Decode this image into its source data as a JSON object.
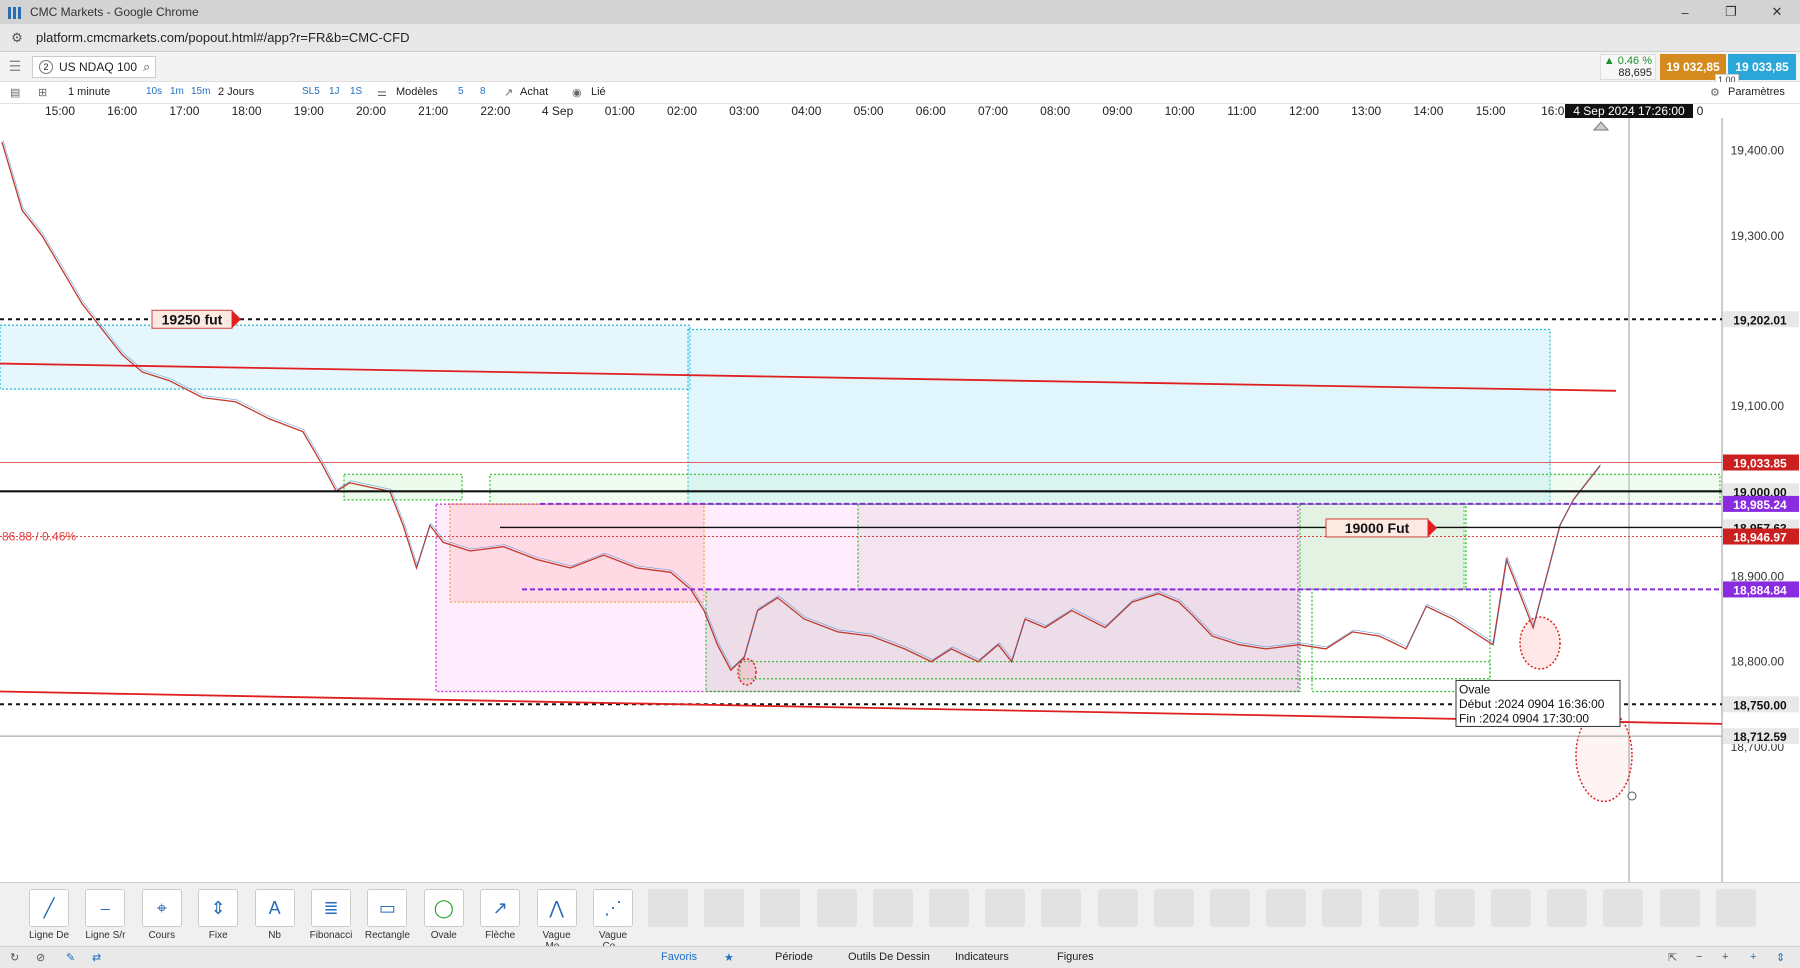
{
  "window": {
    "title": "CMC Markets - Google Chrome",
    "controls": [
      "–",
      "❐",
      "✕"
    ]
  },
  "address": {
    "url": "platform.cmcmarkets.com/popout.html#/app?r=FR&b=CMC-CFD"
  },
  "instrument": {
    "number": "2",
    "name": "US NDAQ 100"
  },
  "quote": {
    "change_pct": "▲ 0.46 %",
    "change_pts": "88,695",
    "sell": "19 032,85",
    "buy": "19 033,85",
    "lot": "1.00"
  },
  "toolbar": {
    "interval": "1 minute",
    "intervals": [
      "10s",
      "1m",
      "15m"
    ],
    "range": "2 Jours",
    "sl_buttons": [
      "SL5",
      "1J",
      "1S"
    ],
    "modeles": "Modèles",
    "counts": [
      "5",
      "8"
    ],
    "achat": "Achat",
    "lie": "Lié",
    "parametres": "Paramètres"
  },
  "chart_data": {
    "type": "candlestick",
    "instrument": "US NDAQ 100",
    "x_tick_labels": [
      "15:00",
      "16:00",
      "17:00",
      "18:00",
      "19:00",
      "20:00",
      "21:00",
      "22:00",
      "4 Sep",
      "01:00",
      "02:00",
      "03:00",
      "04:00",
      "05:00",
      "06:00",
      "07:00",
      "08:00",
      "09:00",
      "10:00",
      "11:00",
      "12:00",
      "13:00",
      "14:00",
      "15:00",
      "16:0"
    ],
    "crosshair_time": "4 Sep 2024 17:26:00",
    "crosshair_tail": "0",
    "y_tick_labels": [
      "19,400.00",
      "19,300.00",
      "19,200.00",
      "19,100.00",
      "19,000.00",
      "18,900.00",
      "18,800.00",
      "18,700.00"
    ],
    "ylim": [
      18640,
      19450
    ],
    "price_tags": [
      {
        "value": 19202.01,
        "label": "19,202.01",
        "bg": "#e8e8e8",
        "fg": "#111"
      },
      {
        "value": 19033.85,
        "label": "19,033.85",
        "bg": "#cc1f1f",
        "fg": "#fff"
      },
      {
        "value": 19000.0,
        "label": "19,000.00",
        "bg": "#e8e8e8",
        "fg": "#111"
      },
      {
        "value": 18985.24,
        "label": "18,985.24",
        "bg": "#8a2be2",
        "fg": "#fff"
      },
      {
        "value": 18957.63,
        "label": "18,957.63",
        "bg": "#e8e8e8",
        "fg": "#111"
      },
      {
        "value": 18946.97,
        "label": "18,946.97",
        "bg": "#cc1f1f",
        "fg": "#fff"
      },
      {
        "value": 18884.84,
        "label": "18,884.84",
        "bg": "#8a2be2",
        "fg": "#fff"
      },
      {
        "value": 18750.0,
        "label": "18,750.00",
        "bg": "#e8e8e8",
        "fg": "#111"
      },
      {
        "value": 18712.59,
        "label": "18,712.59",
        "bg": "#e8e8e8",
        "fg": "#111"
      }
    ],
    "change_label": "86.88 / 0.46%",
    "annotations": [
      "19250  fut",
      "19000  Fut"
    ],
    "tooltip": {
      "title": "Ovale",
      "start": "Début :2024 0904 16:36:00",
      "end": "Fin :2024 0904 17:30:00"
    },
    "price_path": [
      [
        0,
        19410
      ],
      [
        6,
        19330
      ],
      [
        12,
        19300
      ],
      [
        18,
        19260
      ],
      [
        24,
        19220
      ],
      [
        30,
        19190
      ],
      [
        36,
        19160
      ],
      [
        42,
        19140
      ],
      [
        50,
        19130
      ],
      [
        60,
        19110
      ],
      [
        70,
        19105
      ],
      [
        80,
        19085
      ],
      [
        90,
        19070
      ],
      [
        96,
        19030
      ],
      [
        100,
        19000
      ],
      [
        104,
        19010
      ],
      [
        110,
        19005
      ],
      [
        116,
        19000
      ],
      [
        120,
        18960
      ],
      [
        124,
        18910
      ],
      [
        128,
        18960
      ],
      [
        132,
        18940
      ],
      [
        140,
        18930
      ],
      [
        150,
        18935
      ],
      [
        160,
        18920
      ],
      [
        170,
        18910
      ],
      [
        180,
        18925
      ],
      [
        190,
        18910
      ],
      [
        200,
        18905
      ],
      [
        206,
        18885
      ],
      [
        210,
        18860
      ],
      [
        214,
        18820
      ],
      [
        218,
        18790
      ],
      [
        222,
        18805
      ],
      [
        226,
        18860
      ],
      [
        232,
        18875
      ],
      [
        240,
        18850
      ],
      [
        250,
        18835
      ],
      [
        260,
        18830
      ],
      [
        270,
        18815
      ],
      [
        278,
        18800
      ],
      [
        284,
        18815
      ],
      [
        292,
        18800
      ],
      [
        298,
        18820
      ],
      [
        302,
        18800
      ],
      [
        306,
        18850
      ],
      [
        312,
        18840
      ],
      [
        320,
        18860
      ],
      [
        330,
        18840
      ],
      [
        338,
        18870
      ],
      [
        346,
        18880
      ],
      [
        352,
        18870
      ],
      [
        356,
        18855
      ],
      [
        362,
        18830
      ],
      [
        370,
        18820
      ],
      [
        378,
        18815
      ],
      [
        388,
        18820
      ],
      [
        396,
        18815
      ],
      [
        404,
        18835
      ],
      [
        412,
        18830
      ],
      [
        420,
        18815
      ],
      [
        426,
        18865
      ],
      [
        434,
        18850
      ],
      [
        440,
        18835
      ],
      [
        446,
        18820
      ],
      [
        450,
        18920
      ],
      [
        454,
        18880
      ],
      [
        458,
        18840
      ],
      [
        462,
        18900
      ],
      [
        466,
        18960
      ],
      [
        470,
        18990
      ],
      [
        474,
        19010
      ],
      [
        478,
        19030
      ]
    ]
  },
  "drawing_tools": [
    "Ligne De ...",
    "Ligne S/r",
    "Cours",
    "Fixe",
    "Nb",
    "Fibonacci",
    "Rectangle",
    "Ovale",
    "Flèche",
    "Vague Mo...",
    "Vague Co..."
  ],
  "bottom_tabs": {
    "favoris": "Favoris",
    "periode": "Période",
    "outils": "Outils De Dessin",
    "indicateurs": "Indicateurs",
    "figures": "Figures"
  }
}
